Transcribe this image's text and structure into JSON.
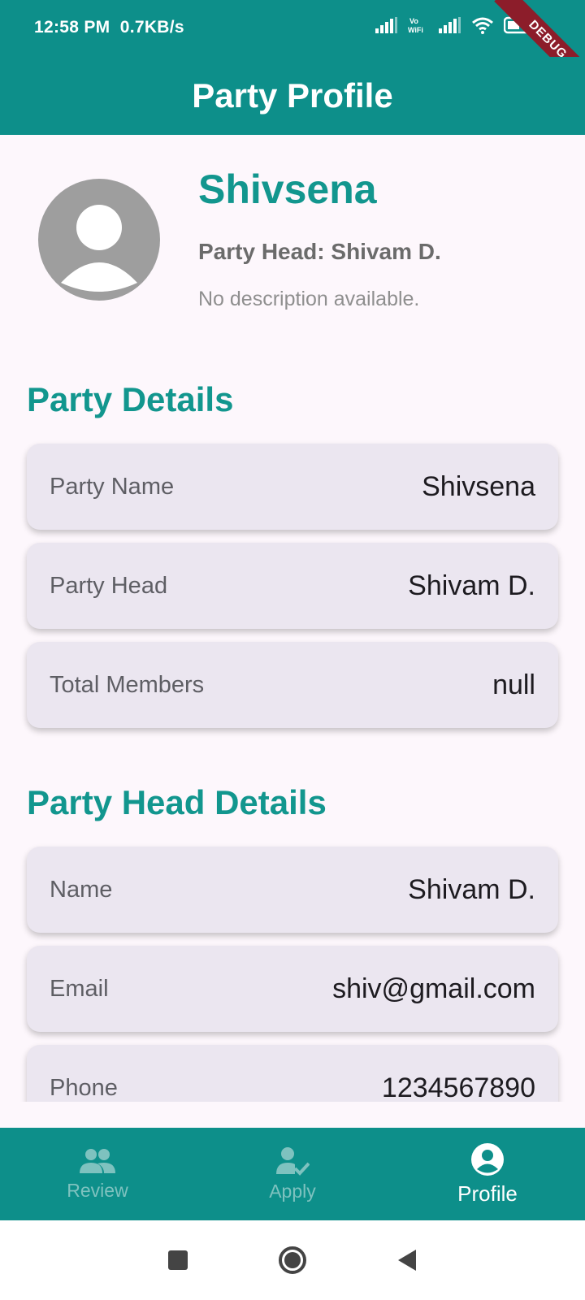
{
  "status_bar": {
    "time": "12:58 PM",
    "speed": "0.7KB/s",
    "debug_label": "DEBUG"
  },
  "app_bar": {
    "title": "Party Profile"
  },
  "profile": {
    "party_name": "Shivsena",
    "head_line": "Party Head: Shivam D.",
    "description": "No description available."
  },
  "party_details": {
    "title": "Party Details",
    "rows": [
      {
        "label": "Party Name",
        "value": "Shivsena"
      },
      {
        "label": "Party Head",
        "value": "Shivam D."
      },
      {
        "label": "Total Members",
        "value": "null"
      }
    ]
  },
  "head_details": {
    "title": "Party Head Details",
    "rows": [
      {
        "label": "Name",
        "value": "Shivam D."
      },
      {
        "label": "Email",
        "value": "shiv@gmail.com"
      },
      {
        "label": "Phone",
        "value": "1234567890"
      }
    ]
  },
  "bottom_nav": {
    "items": [
      {
        "label": "Review",
        "icon": "people-icon",
        "active": false
      },
      {
        "label": "Apply",
        "icon": "person-check-icon",
        "active": false
      },
      {
        "label": "Profile",
        "icon": "account-circle-icon",
        "active": true
      }
    ]
  },
  "colors": {
    "primary": "#0d8f8a",
    "accent_text": "#12968e",
    "card_bg": "#ebe6f0",
    "page_bg": "#fdf7fc"
  }
}
